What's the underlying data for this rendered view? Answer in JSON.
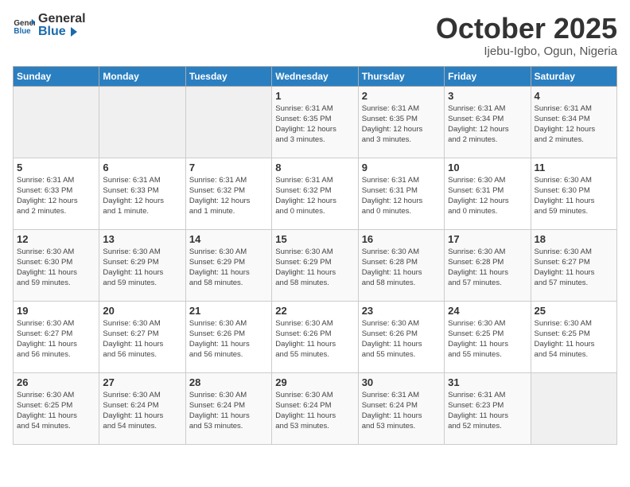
{
  "logo": {
    "general": "General",
    "blue": "Blue"
  },
  "header": {
    "month": "October 2025",
    "location": "Ijebu-Igbo, Ogun, Nigeria"
  },
  "weekdays": [
    "Sunday",
    "Monday",
    "Tuesday",
    "Wednesday",
    "Thursday",
    "Friday",
    "Saturday"
  ],
  "weeks": [
    [
      {
        "day": "",
        "info": ""
      },
      {
        "day": "",
        "info": ""
      },
      {
        "day": "",
        "info": ""
      },
      {
        "day": "1",
        "info": "Sunrise: 6:31 AM\nSunset: 6:35 PM\nDaylight: 12 hours\nand 3 minutes."
      },
      {
        "day": "2",
        "info": "Sunrise: 6:31 AM\nSunset: 6:35 PM\nDaylight: 12 hours\nand 3 minutes."
      },
      {
        "day": "3",
        "info": "Sunrise: 6:31 AM\nSunset: 6:34 PM\nDaylight: 12 hours\nand 2 minutes."
      },
      {
        "day": "4",
        "info": "Sunrise: 6:31 AM\nSunset: 6:34 PM\nDaylight: 12 hours\nand 2 minutes."
      }
    ],
    [
      {
        "day": "5",
        "info": "Sunrise: 6:31 AM\nSunset: 6:33 PM\nDaylight: 12 hours\nand 2 minutes."
      },
      {
        "day": "6",
        "info": "Sunrise: 6:31 AM\nSunset: 6:33 PM\nDaylight: 12 hours\nand 1 minute."
      },
      {
        "day": "7",
        "info": "Sunrise: 6:31 AM\nSunset: 6:32 PM\nDaylight: 12 hours\nand 1 minute."
      },
      {
        "day": "8",
        "info": "Sunrise: 6:31 AM\nSunset: 6:32 PM\nDaylight: 12 hours\nand 0 minutes."
      },
      {
        "day": "9",
        "info": "Sunrise: 6:31 AM\nSunset: 6:31 PM\nDaylight: 12 hours\nand 0 minutes."
      },
      {
        "day": "10",
        "info": "Sunrise: 6:30 AM\nSunset: 6:31 PM\nDaylight: 12 hours\nand 0 minutes."
      },
      {
        "day": "11",
        "info": "Sunrise: 6:30 AM\nSunset: 6:30 PM\nDaylight: 11 hours\nand 59 minutes."
      }
    ],
    [
      {
        "day": "12",
        "info": "Sunrise: 6:30 AM\nSunset: 6:30 PM\nDaylight: 11 hours\nand 59 minutes."
      },
      {
        "day": "13",
        "info": "Sunrise: 6:30 AM\nSunset: 6:29 PM\nDaylight: 11 hours\nand 59 minutes."
      },
      {
        "day": "14",
        "info": "Sunrise: 6:30 AM\nSunset: 6:29 PM\nDaylight: 11 hours\nand 58 minutes."
      },
      {
        "day": "15",
        "info": "Sunrise: 6:30 AM\nSunset: 6:29 PM\nDaylight: 11 hours\nand 58 minutes."
      },
      {
        "day": "16",
        "info": "Sunrise: 6:30 AM\nSunset: 6:28 PM\nDaylight: 11 hours\nand 58 minutes."
      },
      {
        "day": "17",
        "info": "Sunrise: 6:30 AM\nSunset: 6:28 PM\nDaylight: 11 hours\nand 57 minutes."
      },
      {
        "day": "18",
        "info": "Sunrise: 6:30 AM\nSunset: 6:27 PM\nDaylight: 11 hours\nand 57 minutes."
      }
    ],
    [
      {
        "day": "19",
        "info": "Sunrise: 6:30 AM\nSunset: 6:27 PM\nDaylight: 11 hours\nand 56 minutes."
      },
      {
        "day": "20",
        "info": "Sunrise: 6:30 AM\nSunset: 6:27 PM\nDaylight: 11 hours\nand 56 minutes."
      },
      {
        "day": "21",
        "info": "Sunrise: 6:30 AM\nSunset: 6:26 PM\nDaylight: 11 hours\nand 56 minutes."
      },
      {
        "day": "22",
        "info": "Sunrise: 6:30 AM\nSunset: 6:26 PM\nDaylight: 11 hours\nand 55 minutes."
      },
      {
        "day": "23",
        "info": "Sunrise: 6:30 AM\nSunset: 6:26 PM\nDaylight: 11 hours\nand 55 minutes."
      },
      {
        "day": "24",
        "info": "Sunrise: 6:30 AM\nSunset: 6:25 PM\nDaylight: 11 hours\nand 55 minutes."
      },
      {
        "day": "25",
        "info": "Sunrise: 6:30 AM\nSunset: 6:25 PM\nDaylight: 11 hours\nand 54 minutes."
      }
    ],
    [
      {
        "day": "26",
        "info": "Sunrise: 6:30 AM\nSunset: 6:25 PM\nDaylight: 11 hours\nand 54 minutes."
      },
      {
        "day": "27",
        "info": "Sunrise: 6:30 AM\nSunset: 6:24 PM\nDaylight: 11 hours\nand 54 minutes."
      },
      {
        "day": "28",
        "info": "Sunrise: 6:30 AM\nSunset: 6:24 PM\nDaylight: 11 hours\nand 53 minutes."
      },
      {
        "day": "29",
        "info": "Sunrise: 6:30 AM\nSunset: 6:24 PM\nDaylight: 11 hours\nand 53 minutes."
      },
      {
        "day": "30",
        "info": "Sunrise: 6:31 AM\nSunset: 6:24 PM\nDaylight: 11 hours\nand 53 minutes."
      },
      {
        "day": "31",
        "info": "Sunrise: 6:31 AM\nSunset: 6:23 PM\nDaylight: 11 hours\nand 52 minutes."
      },
      {
        "day": "",
        "info": ""
      }
    ]
  ]
}
